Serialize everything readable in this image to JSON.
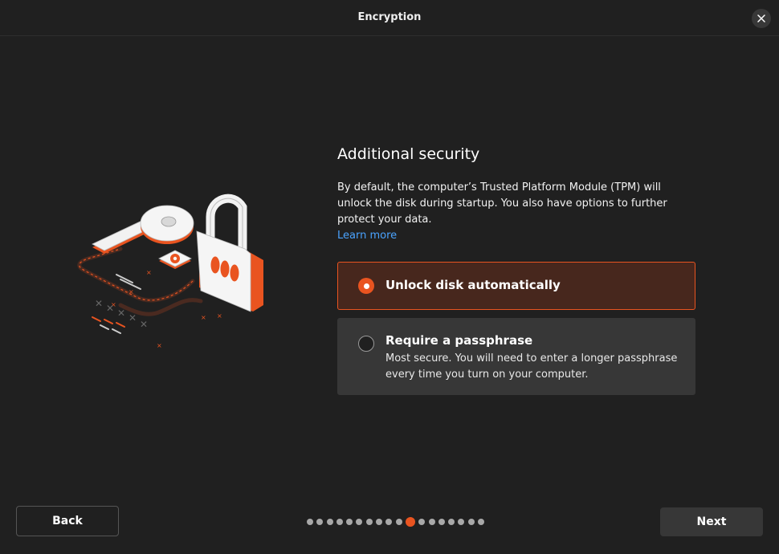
{
  "window": {
    "title": "Encryption",
    "close_icon": "close-icon"
  },
  "page": {
    "heading": "Additional security",
    "description": "By default, the computer’s Trusted Platform Module (TPM) will unlock the disk during startup. You also have options to further protect your data.",
    "learn_more": "Learn more"
  },
  "options": [
    {
      "label": "Unlock disk automatically",
      "selected": true
    },
    {
      "label": "Require a passphrase",
      "subtitle": "Most secure. You will need to enter a longer passphrase every time you turn on your computer.",
      "selected": false
    }
  ],
  "footer": {
    "back_label": "Back",
    "next_label": "Next",
    "progress": {
      "total_steps": 18,
      "current_step": 11
    }
  },
  "colors": {
    "accent": "#e95420",
    "link": "#4aa3ff",
    "background": "#202020",
    "selected_option_bg": "#47271d"
  }
}
